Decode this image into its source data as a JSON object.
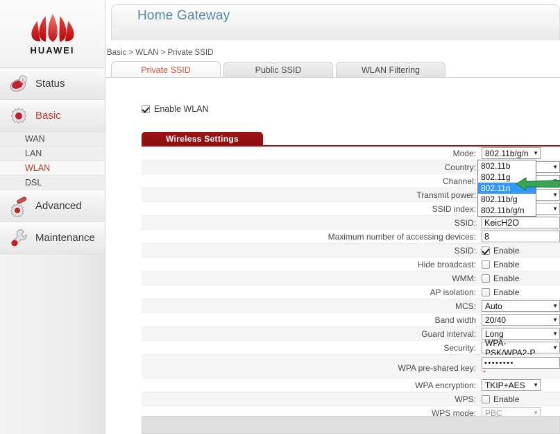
{
  "brand": {
    "name": "HUAWEI",
    "logo_icon": "huawei-flower-logo"
  },
  "header": {
    "title": "Home Gateway",
    "breadcrumb": "Basic > WLAN > Private SSID"
  },
  "sidebar": {
    "items": [
      {
        "label": "Status",
        "icon": "status-info-icon",
        "active": false
      },
      {
        "label": "Basic",
        "icon": "gear-icon",
        "active": true
      },
      {
        "label": "Advanced",
        "icon": "advanced-gear-icon",
        "active": false
      },
      {
        "label": "Maintenance",
        "icon": "wrench-icon",
        "active": false
      }
    ],
    "basic_subitems": [
      {
        "label": "WAN",
        "active": false
      },
      {
        "label": "LAN",
        "active": false
      },
      {
        "label": "WLAN",
        "active": true
      },
      {
        "label": "DSL",
        "active": false
      }
    ]
  },
  "tabs": [
    {
      "label": "Private SSID",
      "active": true
    },
    {
      "label": "Public SSID",
      "active": false
    },
    {
      "label": "WLAN Filtering",
      "active": false
    }
  ],
  "enable_wlan": {
    "label": "Enable WLAN",
    "checked": true
  },
  "section": {
    "title": "Wireless Settings"
  },
  "form": {
    "mode": {
      "label": "Mode:",
      "value": "802.11b/g/n"
    },
    "country": {
      "label": "Country:",
      "value": ""
    },
    "channel": {
      "label": "Channel:",
      "value": ""
    },
    "transmit_power": {
      "label": "Transmit power:",
      "value": ""
    },
    "ssid_index": {
      "label": "SSID index:",
      "value": ""
    },
    "ssid": {
      "label": "SSID:",
      "value": "KeicH2O"
    },
    "max_devices": {
      "label": "Maximum number of accessing devices:",
      "value": "8"
    },
    "ssid_enable": {
      "label": "SSID:",
      "enable_label": "Enable",
      "checked": true
    },
    "hide_broadcast": {
      "label": "Hide broadcast:",
      "enable_label": "Enable",
      "checked": false
    },
    "wmm": {
      "label": "WMM:",
      "enable_label": "Enable",
      "checked": false
    },
    "ap_isolation": {
      "label": "AP isolation:",
      "enable_label": "Enable",
      "checked": false
    },
    "mcs": {
      "label": "MCS:",
      "value": "Auto"
    },
    "band_width": {
      "label": "Band width",
      "value": "20/40"
    },
    "guard_interval": {
      "label": "Guard interval:",
      "value": "Long"
    },
    "security": {
      "label": "Security:",
      "value": "WPA-PSK/WPA2-P"
    },
    "wpa_key": {
      "label": "WPA pre-shared key:",
      "value": "••••••••",
      "required_mark": "*"
    },
    "wpa_encryption": {
      "label": "WPA encryption:",
      "value": "TKIP+AES"
    },
    "wps": {
      "label": "WPS:",
      "enable_label": "Enable",
      "checked": false
    },
    "wps_mode": {
      "label": "WPS mode:",
      "value": "PBC",
      "disabled": true
    }
  },
  "mode_dropdown": {
    "open": true,
    "options": [
      {
        "label": "802.11b",
        "selected": false
      },
      {
        "label": "802.11g",
        "selected": false
      },
      {
        "label": "802.11n",
        "selected": true
      },
      {
        "label": "802.11b/g",
        "selected": false
      },
      {
        "label": "802.11b/g/n",
        "selected": false
      }
    ]
  },
  "annotation": {
    "arrow": "green-arrow-pointing-left",
    "color": "#2e9b4f"
  },
  "colors": {
    "brand_red": "#c8102e",
    "section_red": "#9c1313",
    "active_link": "#c0392b",
    "title_blue": "#5588a3",
    "highlight_blue": "#3399ff"
  }
}
